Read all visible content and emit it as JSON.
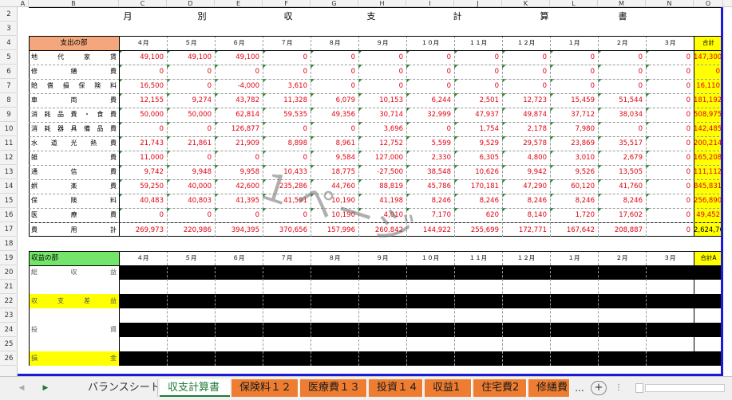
{
  "columns": [
    "A",
    "B",
    "C",
    "D",
    "E",
    "F",
    "G",
    "H",
    "I",
    "J",
    "K",
    "L",
    "M",
    "N",
    "O"
  ],
  "rows": [
    "2",
    "3",
    "4",
    "5",
    "6",
    "7",
    "8",
    "9",
    "10",
    "11",
    "12",
    "13",
    "14",
    "15",
    "16",
    "17",
    "18",
    "19",
    "20",
    "21",
    "22",
    "23",
    "24",
    "25",
    "26"
  ],
  "title_chars": [
    "月",
    "別",
    "収",
    "支",
    "計",
    "算",
    "書"
  ],
  "expense": {
    "header": "支出の部",
    "months": [
      "４月",
      "５月",
      "６月",
      "７月",
      "８月",
      "９月",
      "１０月",
      "１１月",
      "１２月",
      "１月",
      "２月",
      "３月"
    ],
    "total_header": "合計",
    "items": [
      {
        "label": "地代家賃",
        "values": [
          "49,100",
          "49,100",
          "49,100",
          "0",
          "0",
          "0",
          "0",
          "0",
          "0",
          "0",
          "0",
          "0"
        ],
        "total": "147,300"
      },
      {
        "label": "修繕費",
        "values": [
          "0",
          "0",
          "0",
          "0",
          "0",
          "0",
          "0",
          "0",
          "0",
          "0",
          "0",
          "0"
        ],
        "total": "0"
      },
      {
        "label": "賠償損保険料",
        "values": [
          "16,500",
          "0",
          "-4,000",
          "3,610",
          "0",
          "0",
          "0",
          "0",
          "0",
          "0",
          "0",
          "0"
        ],
        "total": "16,110"
      },
      {
        "label": "車両費",
        "values": [
          "12,155",
          "9,274",
          "43,782",
          "11,328",
          "6,079",
          "10,153",
          "6,244",
          "2,501",
          "12,723",
          "15,459",
          "51,544",
          "0"
        ],
        "total": "181,192"
      },
      {
        "label": "消耗品費・食費",
        "values": [
          "50,000",
          "50,000",
          "62,814",
          "59,535",
          "49,356",
          "30,714",
          "32,999",
          "47,937",
          "49,874",
          "37,712",
          "38,034",
          "0"
        ],
        "total": "508,975"
      },
      {
        "label": "消耗器具備品費",
        "values": [
          "0",
          "0",
          "126,877",
          "0",
          "0",
          "3,696",
          "0",
          "1,754",
          "2,178",
          "7,980",
          "0",
          "0"
        ],
        "total": "142,485"
      },
      {
        "label": "水道光熱費",
        "values": [
          "21,743",
          "21,861",
          "21,909",
          "8,898",
          "8,961",
          "12,752",
          "5,599",
          "9,529",
          "29,578",
          "23,869",
          "35,517",
          "0"
        ],
        "total": "200,214"
      },
      {
        "label": "雑費",
        "values": [
          "11,000",
          "0",
          "0",
          "0",
          "9,584",
          "127,000",
          "2,330",
          "6,305",
          "4,800",
          "3,010",
          "2,679",
          "0"
        ],
        "total": "165,208"
      },
      {
        "label": "通信費",
        "values": [
          "9,742",
          "9,948",
          "9,958",
          "10,433",
          "18,775",
          "-27,500",
          "38,548",
          "10,626",
          "9,942",
          "9,526",
          "13,505",
          "0"
        ],
        "total": "111,112"
      },
      {
        "label": "娯楽費",
        "values": [
          "59,250",
          "40,000",
          "42,600",
          "235,286",
          "44,760",
          "88,819",
          "45,786",
          "170,181",
          "47,290",
          "60,120",
          "41,760",
          "0"
        ],
        "total": "845,831"
      },
      {
        "label": "保険料",
        "values": [
          "40,483",
          "40,803",
          "41,395",
          "41,591",
          "10,190",
          "41,198",
          "8,246",
          "8,246",
          "8,246",
          "8,246",
          "8,246",
          "0"
        ],
        "total": "256,890"
      },
      {
        "label": "医療費",
        "values": [
          "0",
          "0",
          "0",
          "0",
          "10,190",
          "4,010",
          "7,170",
          "620",
          "8,140",
          "1,720",
          "17,602",
          "0"
        ],
        "total": "49,452"
      }
    ],
    "sum_label": "費用計",
    "sums": [
      "269,973",
      "220,986",
      "394,395",
      "370,656",
      "157,996",
      "260,842",
      "144,922",
      "255,699",
      "172,771",
      "167,642",
      "208,887",
      "0"
    ],
    "sum_total": "2,624,769"
  },
  "income": {
    "header": "収益の部",
    "months": [
      "４月",
      "５月",
      "６月",
      "７月",
      "８月",
      "９月",
      "１０月",
      "１１月",
      "１２月",
      "１月",
      "２月",
      "３月"
    ],
    "total_header": "合計A",
    "rows": [
      {
        "row": "20",
        "label": "総収益"
      },
      {
        "row": "22",
        "label": "収支差益"
      },
      {
        "row": "24",
        "label": "投資"
      },
      {
        "row": "26",
        "label": "損金"
      }
    ]
  },
  "watermark": "１ページ",
  "tabs": {
    "nav_prev": "◀",
    "nav_next": "▶",
    "items": [
      "バランスシート",
      "収支計算書",
      "保険料１２",
      "医療費１３",
      "投資１４",
      "収益1",
      "住宅費2",
      "修繕費"
    ],
    "active_index": 1,
    "more": "...",
    "add": "+"
  },
  "colors": {
    "expense_header": "#f4a77c",
    "income_header": "#74e56a",
    "total_fill": "#ffff00",
    "neg": "#e2000f",
    "tab_orange": "#ef7d31",
    "frame": "#1b1bd6"
  }
}
